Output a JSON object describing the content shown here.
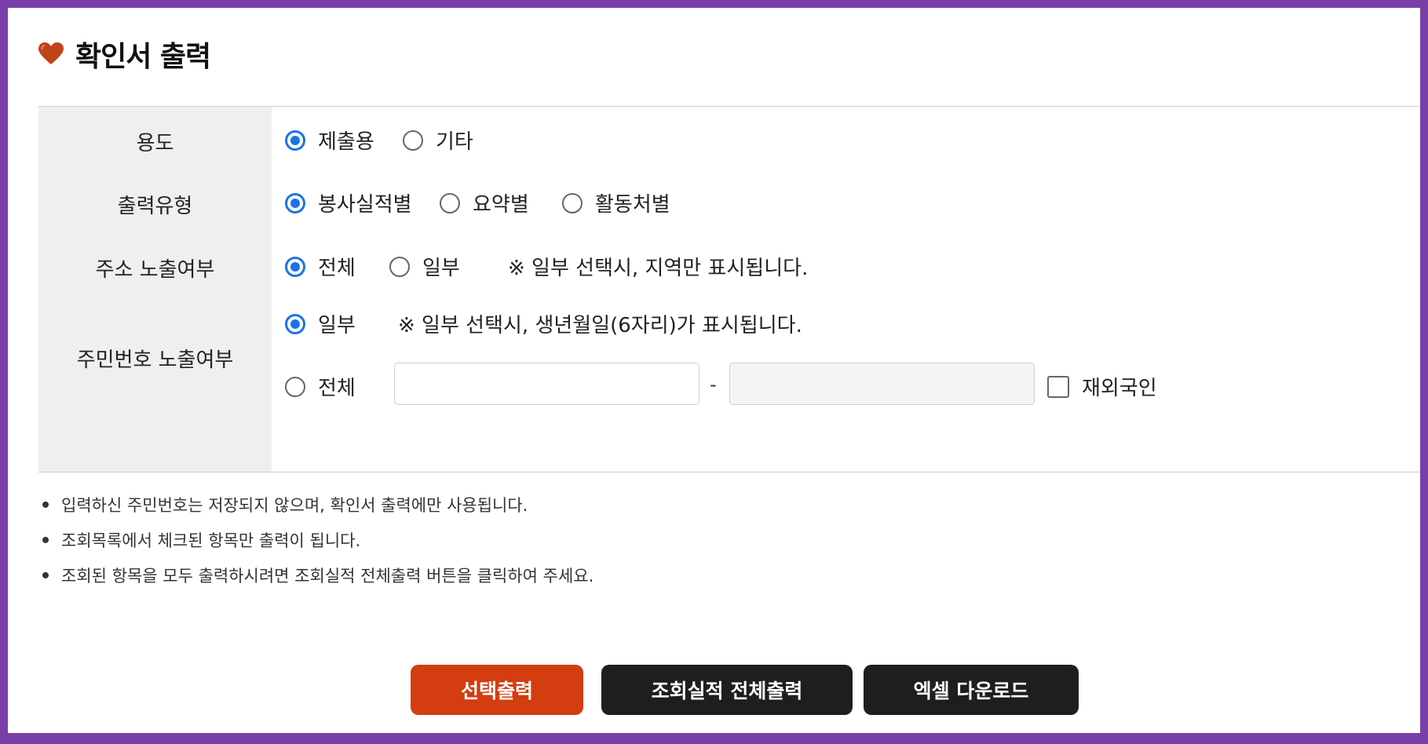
{
  "page": {
    "title": "확인서 출력",
    "title_icon": "heart-icon",
    "accent_color": "#d33d0f",
    "frame_color": "#7a3ea8"
  },
  "form": {
    "purpose": {
      "label": "용도",
      "options": [
        {
          "label": "제출용",
          "selected": true
        },
        {
          "label": "기타",
          "selected": false
        }
      ]
    },
    "output_type": {
      "label": "출력유형",
      "options": [
        {
          "label": "봉사실적별",
          "selected": true
        },
        {
          "label": "요약별",
          "selected": false
        },
        {
          "label": "활동처별",
          "selected": false
        }
      ]
    },
    "address_exposure": {
      "label": "주소 노출여부",
      "options": [
        {
          "label": "전체",
          "selected": true
        },
        {
          "label": "일부",
          "selected": false
        }
      ],
      "note": "※ 일부 선택시, 지역만 표시됩니다."
    },
    "rrn_exposure": {
      "label": "주민번호 노출여부",
      "option_partial": {
        "label": "일부",
        "selected": true
      },
      "note": "※ 일부 선택시, 생년월일(6자리)가 표시됩니다.",
      "option_full": {
        "label": "전체",
        "selected": false
      },
      "first_value": "",
      "separator": "-",
      "second_value": "",
      "overseas_label": "재외국인",
      "overseas_checked": false
    }
  },
  "notices": [
    "입력하신 주민번호는 저장되지 않으며, 확인서 출력에만 사용됩니다.",
    "조회목록에서 체크된 항목만 출력이 됩니다.",
    "조회된 항목을 모두 출력하시려면 조회실적 전체출력 버튼을 클릭하여 주세요."
  ],
  "buttons": {
    "print_selected": "선택출력",
    "print_all": "조회실적 전체출력",
    "excel_download": "엑셀 다운로드"
  }
}
